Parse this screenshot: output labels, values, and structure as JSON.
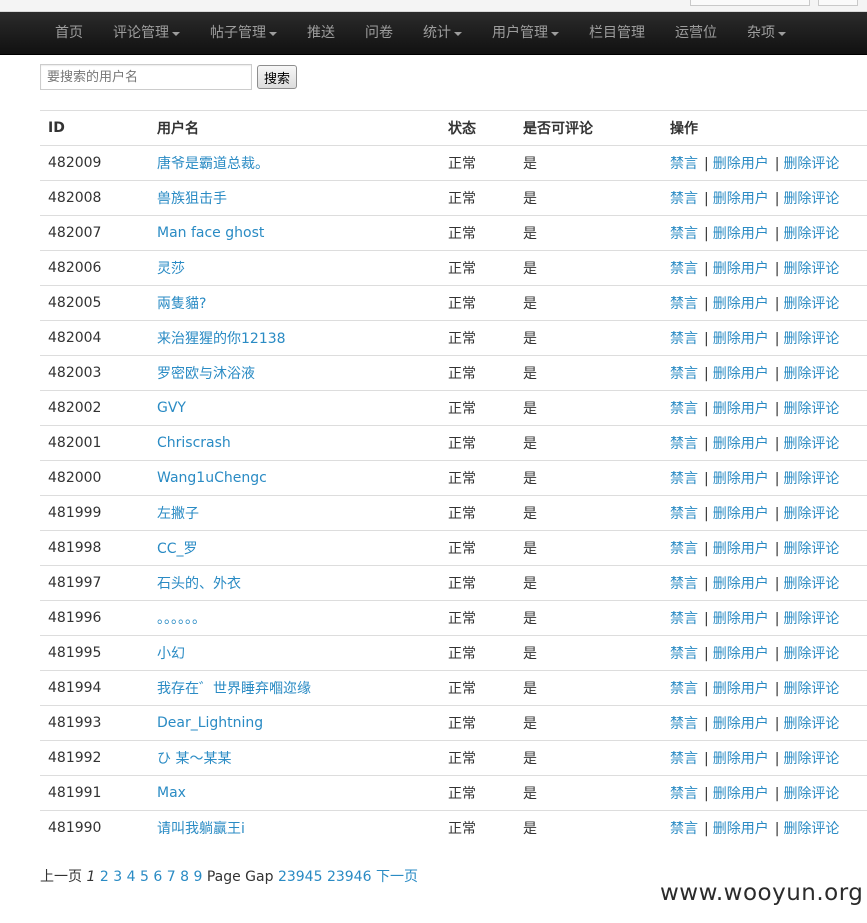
{
  "nav": {
    "items": [
      {
        "label": "首页",
        "dropdown": false
      },
      {
        "label": "评论管理",
        "dropdown": true
      },
      {
        "label": "帖子管理",
        "dropdown": true
      },
      {
        "label": "推送",
        "dropdown": false
      },
      {
        "label": "问卷",
        "dropdown": false
      },
      {
        "label": "统计",
        "dropdown": true
      },
      {
        "label": "用户管理",
        "dropdown": true
      },
      {
        "label": "栏目管理",
        "dropdown": false
      },
      {
        "label": "运营位",
        "dropdown": false
      },
      {
        "label": "杂项",
        "dropdown": true
      }
    ]
  },
  "search": {
    "placeholder": "要搜索的用户名",
    "value": "",
    "button_label": "搜索"
  },
  "table": {
    "headers": {
      "id": "ID",
      "username": "用户名",
      "status": "状态",
      "can_comment": "是否可评论",
      "actions": "操作"
    },
    "actions": {
      "ban": "禁言",
      "delete_user": "删除用户",
      "delete_comments": "删除评论",
      "separator": "|"
    },
    "rows": [
      {
        "id": "482009",
        "username": "唐爷是霸道总裁。",
        "status": "正常",
        "can_comment": "是"
      },
      {
        "id": "482008",
        "username": "兽族狙击手",
        "status": "正常",
        "can_comment": "是"
      },
      {
        "id": "482007",
        "username": "Man face ghost",
        "status": "正常",
        "can_comment": "是"
      },
      {
        "id": "482006",
        "username": "灵莎",
        "status": "正常",
        "can_comment": "是"
      },
      {
        "id": "482005",
        "username": "兩隻貓?",
        "status": "正常",
        "can_comment": "是"
      },
      {
        "id": "482004",
        "username": "来治猩猩的你12138",
        "status": "正常",
        "can_comment": "是"
      },
      {
        "id": "482003",
        "username": "罗密欧与沐浴液",
        "status": "正常",
        "can_comment": "是"
      },
      {
        "id": "482002",
        "username": "GVY",
        "status": "正常",
        "can_comment": "是"
      },
      {
        "id": "482001",
        "username": "Chriscrash",
        "status": "正常",
        "can_comment": "是"
      },
      {
        "id": "482000",
        "username": "Wang1uChengc",
        "status": "正常",
        "can_comment": "是"
      },
      {
        "id": "481999",
        "username": "左撇子",
        "status": "正常",
        "can_comment": "是"
      },
      {
        "id": "481998",
        "username": "CC_罗",
        "status": "正常",
        "can_comment": "是"
      },
      {
        "id": "481997",
        "username": "石头的、外衣",
        "status": "正常",
        "can_comment": "是"
      },
      {
        "id": "481996",
        "username": "。。。。。。",
        "status": "正常",
        "can_comment": "是"
      },
      {
        "id": "481995",
        "username": "小幻",
        "status": "正常",
        "can_comment": "是"
      },
      {
        "id": "481994",
        "username": "我存在゛世界睡弃嗰迩缘",
        "status": "正常",
        "can_comment": "是"
      },
      {
        "id": "481993",
        "username": "Dear_Lightning",
        "status": "正常",
        "can_comment": "是"
      },
      {
        "id": "481992",
        "username": "ひ 某～某某",
        "status": "正常",
        "can_comment": "是"
      },
      {
        "id": "481991",
        "username": "Max",
        "status": "正常",
        "can_comment": "是"
      },
      {
        "id": "481990",
        "username": "请叫我躺赢王i",
        "status": "正常",
        "can_comment": "是"
      }
    ]
  },
  "pager": {
    "prev": "上一页",
    "current": "1",
    "pages": [
      "2",
      "3",
      "4",
      "5",
      "6",
      "7",
      "8",
      "9"
    ],
    "gap_label": "Page Gap",
    "tail_pages": [
      "23945",
      "23946"
    ],
    "next": "下一页"
  },
  "watermark": "www.wooyun.org",
  "colors": {
    "navbar": "#1b1b1b",
    "nav_text": "#9d9d9d",
    "link": "#2a8bc4",
    "text": "#333333"
  }
}
